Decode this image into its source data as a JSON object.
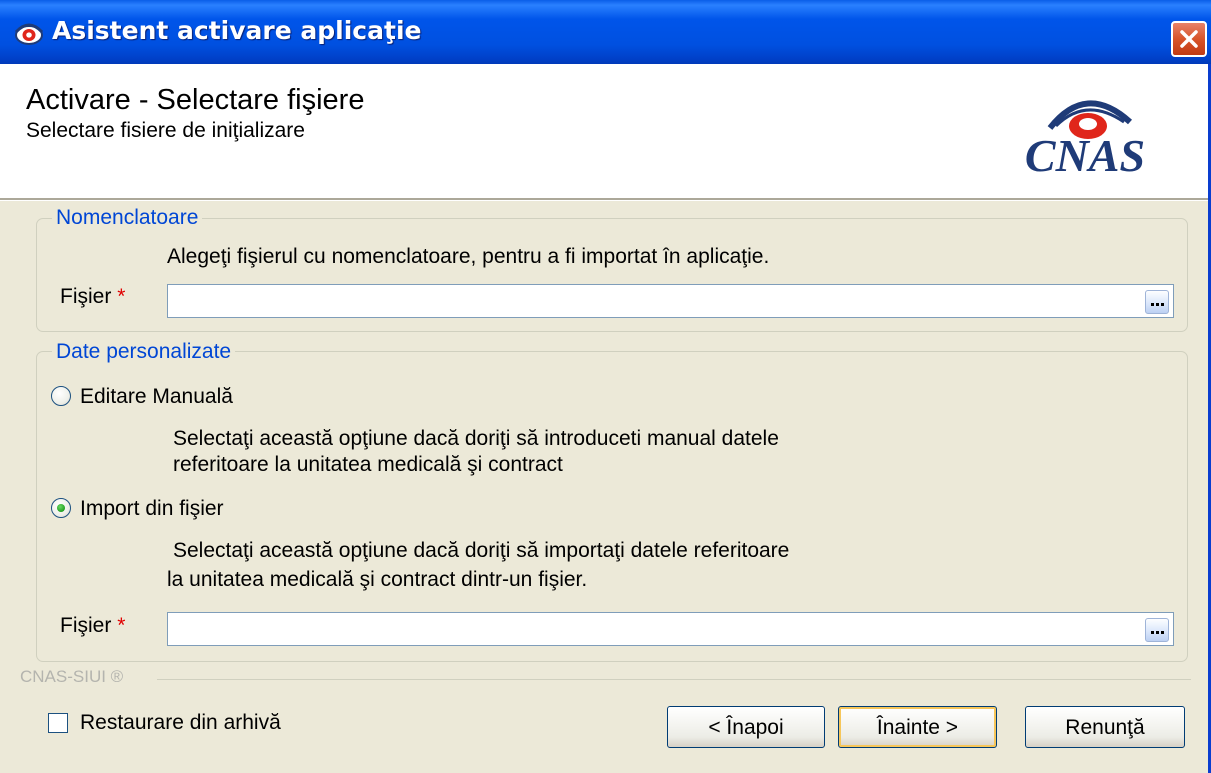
{
  "window": {
    "title": "Asistent activare aplicaţie",
    "close_label": "Închide"
  },
  "header": {
    "title": "Activare - Selectare fişiere",
    "subtitle": "Selectare fisiere de iniţializare",
    "logo_text": "CNAS"
  },
  "nomenclatoare": {
    "legend": "Nomenclatoare",
    "description": "Alegeţi fişierul cu nomenclatoare, pentru a fi importat în aplicaţie.",
    "file_label": "Fişier",
    "required_mark": "*",
    "file_value": "",
    "browse_label": "..."
  },
  "personal_data": {
    "legend": "Date personalizate",
    "manual_option": {
      "label": "Editare Manuală",
      "selected": false,
      "desc_line1": "Selectaţi această opţiune dacă doriţi să introduceti manual datele",
      "desc_line2": "referitoare la unitatea medicală şi contract"
    },
    "import_option": {
      "label": "Import din fişier",
      "selected": true,
      "desc_line1": "Selectaţi această opţiune dacă doriţi să importaţi datele referitoare",
      "desc_line2": "la unitatea medicală şi contract dintr-un fişier."
    },
    "file_label": "Fişier",
    "required_mark": "*",
    "file_value": "",
    "browse_label": "..."
  },
  "footer": {
    "brand": "CNAS-SIUI ®",
    "restore_checkbox": {
      "label": "Restaurare din arhivă",
      "checked": false
    },
    "back_button": "< Înapoi",
    "next_button": "Înainte >",
    "cancel_button": "Renunţă"
  },
  "colors": {
    "titlebar": "#0055ea",
    "legend_text": "#0046d5",
    "required": "#e00000",
    "default_button_highlight": "#f6c65a",
    "logo_blue": "#1f3b78",
    "logo_red": "#e0261b"
  },
  "icons": {
    "app": "cnas-logo-icon",
    "close": "close-icon",
    "browse": "browse-icon"
  }
}
